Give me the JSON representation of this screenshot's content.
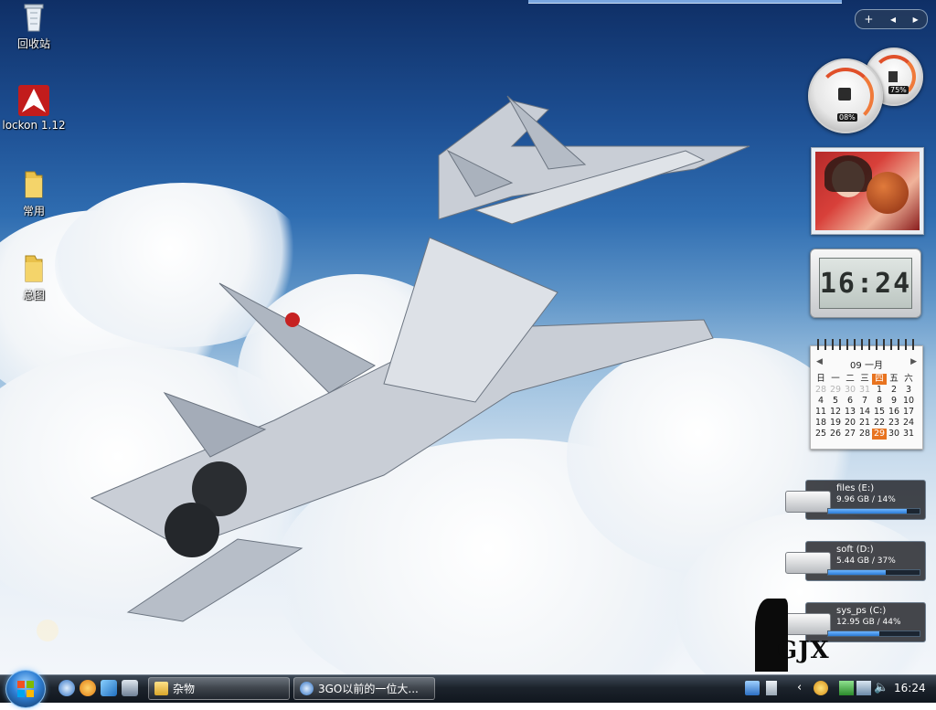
{
  "desktop": {
    "icons": [
      {
        "label": "回收站",
        "icon": "recycle-bin-icon"
      },
      {
        "label": "lockon 1.12",
        "icon": "lockon-app-icon"
      },
      {
        "label": "常用",
        "icon": "folder-icon"
      },
      {
        "label": "总图",
        "icon": "folder-icon"
      }
    ],
    "watermark": "GJX"
  },
  "gadgets": {
    "controls": {
      "add": "+",
      "prev": "◂",
      "next": "▸"
    },
    "cpu_meter": {
      "cpu_percent": "08%",
      "memory_percent": "75%"
    },
    "clock": {
      "time": "16:24"
    },
    "calendar": {
      "month_label": "09 一月",
      "weekdays": [
        "日",
        "一",
        "二",
        "三",
        "四",
        "五",
        "六"
      ],
      "weeks": [
        [
          "28",
          "29",
          "30",
          "31",
          "1",
          "2",
          "3"
        ],
        [
          "4",
          "5",
          "6",
          "7",
          "8",
          "9",
          "10"
        ],
        [
          "11",
          "12",
          "13",
          "14",
          "15",
          "16",
          "17"
        ],
        [
          "18",
          "19",
          "20",
          "21",
          "22",
          "23",
          "24"
        ],
        [
          "25",
          "26",
          "27",
          "28",
          "29",
          "30",
          "31"
        ]
      ],
      "today": "29"
    },
    "drives": [
      {
        "name": "files (E:)",
        "info": "9.96 GB / 14%",
        "used": 0.86
      },
      {
        "name": "soft (D:)",
        "info": "5.44 GB / 37%",
        "used": 0.63
      },
      {
        "name": "sys_ps (C:)",
        "info": "12.95 GB / 44%",
        "used": 0.56
      }
    ]
  },
  "taskbar": {
    "buttons": [
      {
        "label": "杂物",
        "icon": "folder-icon"
      },
      {
        "label": "3GO以前的一位大...",
        "icon": "browser-icon"
      }
    ],
    "clock": "16:24",
    "colors": {
      "taskbar": "#1c232c",
      "accent": "#2f7fd4",
      "today": "#e8731f"
    }
  }
}
